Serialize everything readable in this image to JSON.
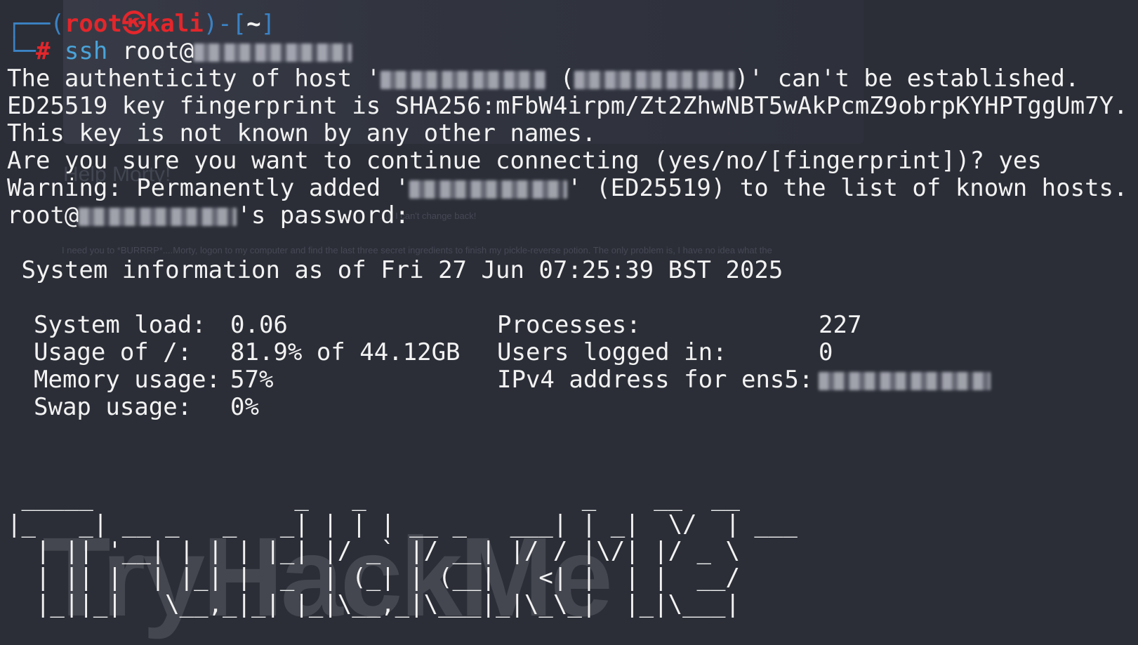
{
  "prompt": {
    "open_paren": "(",
    "user": "root",
    "at_symbol": "㉿",
    "host": "kali",
    "close_paren": ")-[",
    "cwd": "~",
    "close_bracket": "]",
    "hash": "#",
    "command": "ssh",
    "argument": "root@"
  },
  "output": {
    "auth_prefix": "The authenticity of host '",
    "auth_mid": " (",
    "auth_suffix": ")' can't be established.",
    "fingerprint_line": "ED25519 key fingerprint is SHA256:mFbW4irpm/Zt2ZhwNBT5wAkPcmZ9obrpKYHPTggUm7Y.",
    "not_known_line": "This key is not known by any other names.",
    "continue_line": "Are you sure you want to continue connecting (yes/no/[fingerprint])? yes",
    "warning_prefix": "Warning: Permanently added '",
    "warning_suffix": "' (ED25519) to the list of known hosts.",
    "password_prefix": "root@",
    "password_suffix": "'s password:"
  },
  "sysinfo": {
    "header": " System information as of Fri 27 Jun 07:25:39 BST 2025",
    "rows": [
      {
        "label": "System load:  ",
        "value": "0.06",
        "label2": "Processes:",
        "value2": "227"
      },
      {
        "label": "Usage of /:   ",
        "value": "81.9% of 44.12GB",
        "label2": "Users logged in:",
        "value2": "0"
      },
      {
        "label": "Memory usage: ",
        "value": "57%",
        "label2": "IPv4 address for ens5:",
        "value2": ""
      },
      {
        "label": "Swap usage:   ",
        "value": "0%",
        "label2": "",
        "value2": ""
      }
    ]
  },
  "banner": {
    "ascii_lines": [
      " _____              _   _               _    __  __      ",
      "|_   _| __ _   _   _| | | | __ _   ___| | _|  \\/  | ___ ",
      "  | || '__| | | | |_| |/ _` |/ __| |/ / |\\/| |/ _ \\",
      "  | || |  | |_| |  _  | (_| | (__|   <| |  | |  __/",
      "  |_||_|   \\__,_|_| |_|\\__,_|\\___|_|\\_\\_|  |_|\\___|"
    ],
    "watermark": "TryHackMe"
  },
  "background": {
    "heading": "Help Morty!",
    "line1": "…if I can't change back!",
    "line2": "I need you to *BURRRP*....Morty, logon to my computer and find the last three secret ingredients to finish my pickle-reverse potion. The only problem is, I have no idea what the"
  },
  "colors": {
    "background": "#2b2e37",
    "text": "#f2f2f2",
    "prompt_frame": "#3b82c4",
    "prompt_user": "#e4262b",
    "command": "#4aa3d9"
  }
}
